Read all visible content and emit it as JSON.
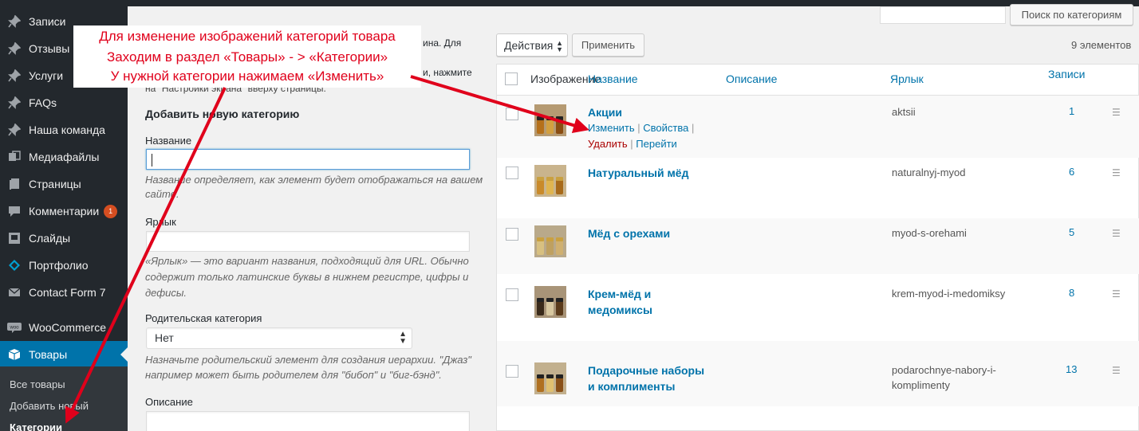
{
  "sidebar": {
    "items": [
      {
        "label": "Записи",
        "icon": "pin-icon"
      },
      {
        "label": "Отзывы",
        "icon": "pin-icon"
      },
      {
        "label": "Услуги",
        "icon": "pin-icon"
      },
      {
        "label": "FAQs",
        "icon": "pin-icon"
      },
      {
        "label": "Наша команда",
        "icon": "pin-icon"
      },
      {
        "label": "Медиафайлы",
        "icon": "media-icon"
      },
      {
        "label": "Страницы",
        "icon": "pages-icon"
      },
      {
        "label": "Комментарии",
        "icon": "comments-icon",
        "badge": "1"
      },
      {
        "label": "Слайды",
        "icon": "slides-icon"
      },
      {
        "label": "Портфолио",
        "icon": "portfolio-icon"
      },
      {
        "label": "Contact Form 7",
        "icon": "mail-icon"
      },
      {
        "label": "WooCommerce",
        "icon": "woocommerce-icon"
      },
      {
        "label": "Товары",
        "icon": "products-icon",
        "active": true
      }
    ],
    "submenu": [
      {
        "label": "Все товары"
      },
      {
        "label": "Добавить новый"
      },
      {
        "label": "Категории",
        "current": true
      }
    ]
  },
  "annotation": {
    "lines": [
      "Для изменение изображений категорий товара",
      "Заходим в раздел «Товары» - > «Категории»",
      "У нужной категории нажимаем «Изменить»"
    ],
    "color": "#e0001b"
  },
  "help": {
    "fragment_1": "ина. Для",
    "fragment_2": "и, нажмите",
    "fragment_3": "на \"Настройки экрана\" вверху страницы."
  },
  "form": {
    "heading": "Добавить новую категорию",
    "name_label": "Название",
    "name_desc_1": "Название определяет, как элемент будет отображаться на вашем",
    "name_desc_2": "сайте.",
    "slug_label": "Ярлык",
    "slug_desc_1": "«Ярлык» — это вариант названия, подходящий для URL. Обычно",
    "slug_desc_2": "содержит только латинские буквы в нижнем регистре, цифры и",
    "slug_desc_3": "дефисы.",
    "parent_label": "Родительская категория",
    "parent_value": "Нет",
    "parent_desc_1": "Назначьте родительский элемент для создания иерархии. \"Джаз\"",
    "parent_desc_2": "например может быть родителем для \"бибоп\" и \"биг-бэнд\".",
    "description_label": "Описание"
  },
  "search": {
    "button": "Поиск по категориям"
  },
  "bulk": {
    "select_value": "Действия",
    "apply": "Применить",
    "count": "9 элементов"
  },
  "table": {
    "columns": {
      "image": "Изображение",
      "name": "Название",
      "description": "Описание",
      "slug": "Ярлык",
      "count": "Записи"
    },
    "row_actions": {
      "edit": "Изменить",
      "props": "Свойства",
      "delete": "Удалить",
      "view": "Перейти",
      "sep": "|"
    },
    "rows": [
      {
        "name_1": "Акции",
        "name_2": "",
        "slug_1": "aktsii",
        "slug_2": "",
        "count": "1"
      },
      {
        "name_1": "Натуральный мёд",
        "name_2": "",
        "slug_1": "naturalnyj-myod",
        "slug_2": "",
        "count": "6"
      },
      {
        "name_1": "Мёд с орехами",
        "name_2": "",
        "slug_1": "myod-s-orehami",
        "slug_2": "",
        "count": "5"
      },
      {
        "name_1": "Крем-мёд и",
        "name_2": "медомиксы",
        "slug_1": "krem-myod-i-medomiksy",
        "slug_2": "",
        "count": "8"
      },
      {
        "name_1": "Подарочные наборы",
        "name_2": "и комплименты",
        "slug_1": "podarochnye-nabory-i-",
        "slug_2": "kompliment​y",
        "count": "13"
      }
    ]
  }
}
